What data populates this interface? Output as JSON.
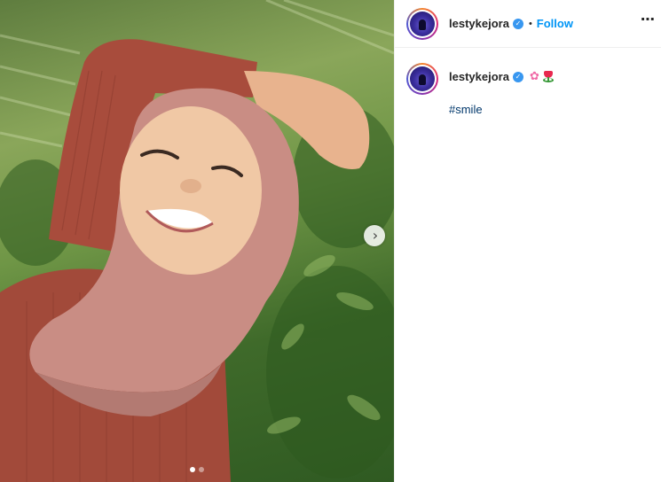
{
  "post": {
    "username": "lestykejora",
    "follow_label": "Follow",
    "separator": "•",
    "more_icon": "⋯",
    "verified_icon": "✓"
  },
  "caption": {
    "username": "lestykejora",
    "emojis": [
      "cherry-blossom",
      "tulip"
    ],
    "flower_glyph": "✿",
    "hashtag": "#smile"
  },
  "carousel": {
    "next_glyph": "›",
    "dot_count": 2,
    "active_index": 0
  },
  "colors": {
    "link_blue": "#0095f6",
    "hashtag_blue": "#00376b",
    "verified_blue": "#3897f0"
  }
}
